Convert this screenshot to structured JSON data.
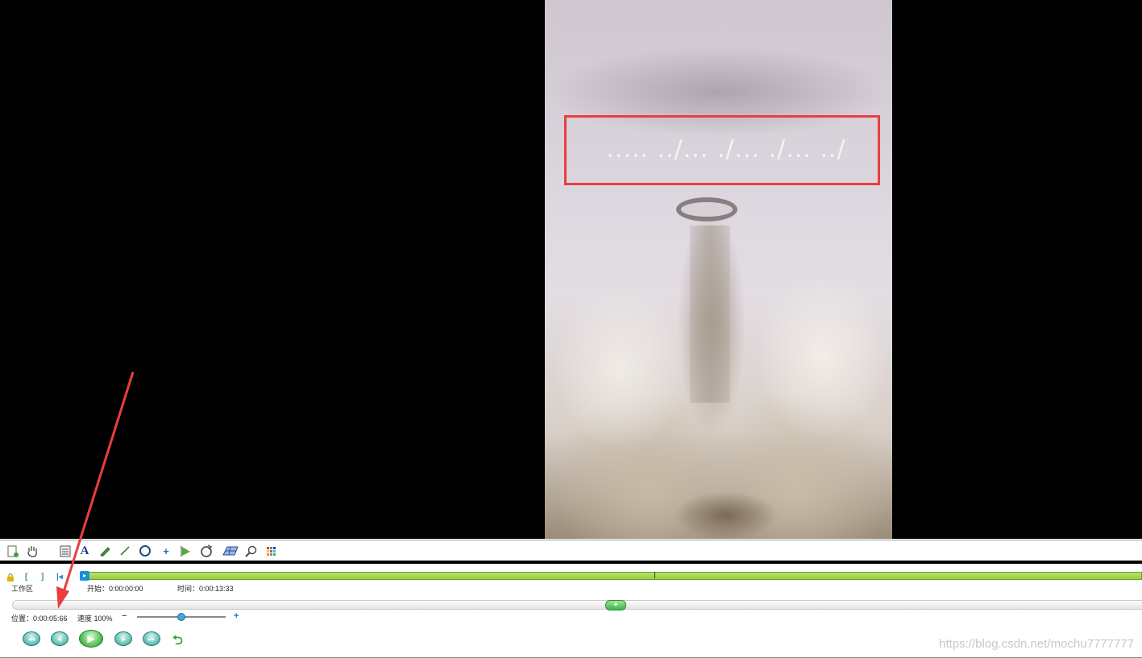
{
  "workspace": {
    "label": "工作区",
    "start_time": "开始：0:00:00:00",
    "duration": "时间：0:00:13:33"
  },
  "playback": {
    "position": "位置：0:00:05:66",
    "speed": "速度 100%"
  },
  "video": {
    "overlay_text": "..... ../... ./... ./... ../"
  },
  "toolbar_icons": [
    "new-document-icon",
    "hand-icon",
    "page-icon",
    "text-icon",
    "pen-icon",
    "line-icon",
    "circle-icon",
    "plus-icon",
    "triangle-flag-icon",
    "rotate-icon",
    "grid-icon",
    "zoom-icon",
    "color-palette-icon"
  ],
  "transport_icons": [
    "rewind-to-start-icon",
    "step-back-icon",
    "play-icon",
    "step-forward-icon",
    "forward-to-end-icon",
    "loop-icon"
  ],
  "colors": {
    "highlight": "#ea3e3e",
    "timeline_green": "#9ccc3f",
    "accent_blue": "#1f8ed6"
  },
  "watermark": "https://blog.csdn.net/mochu7777777"
}
